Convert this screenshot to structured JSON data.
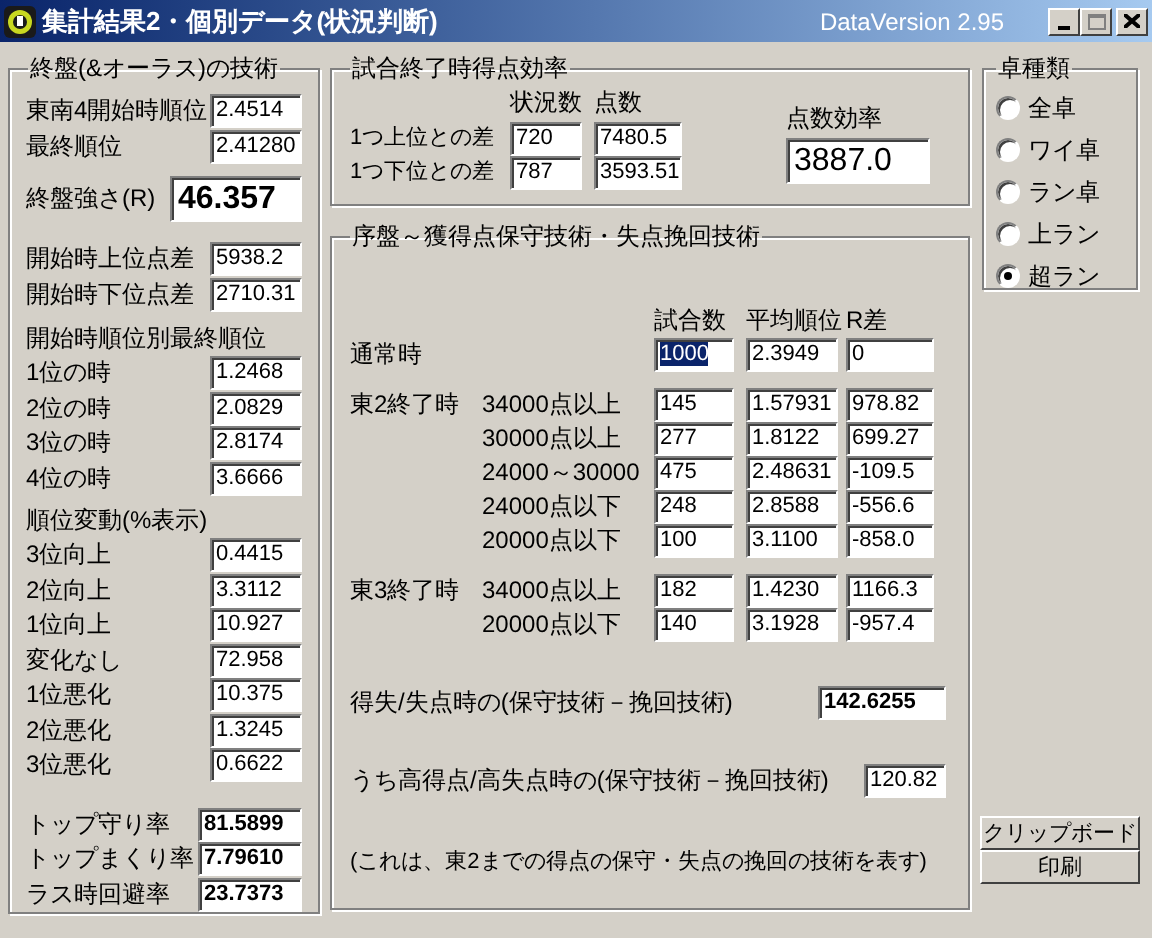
{
  "window": {
    "title": "集計結果2・個別データ(状況判断)",
    "version": "DataVersion 2.95"
  },
  "endgame": {
    "title": "終盤(&オーラス)の技術",
    "sections": [
      {
        "rows": [
          {
            "kind": "normal",
            "label": "東南4開始時順位",
            "value": "2.4514"
          },
          {
            "kind": "normal",
            "label": "最終順位",
            "value": "2.41280"
          },
          {
            "kind": "large",
            "label": "終盤強さ(R)",
            "value": "46.357"
          }
        ]
      },
      {
        "rows": [
          {
            "kind": "normal",
            "label": "開始時上位点差",
            "value": "5938.2"
          },
          {
            "kind": "normal",
            "label": "開始時下位点差",
            "value": "2710.31"
          }
        ]
      },
      {
        "heading": "開始時順位別最終順位",
        "rows": [
          {
            "kind": "normal",
            "label": "1位の時",
            "value": "1.2468"
          },
          {
            "kind": "normal",
            "label": "2位の時",
            "value": "2.0829"
          },
          {
            "kind": "normal",
            "label": "3位の時",
            "value": "2.8174"
          },
          {
            "kind": "normal",
            "label": "4位の時",
            "value": "3.6666"
          }
        ]
      },
      {
        "heading": "順位変動(%表示)",
        "rows": [
          {
            "kind": "normal",
            "label": "3位向上",
            "value": "0.4415"
          },
          {
            "kind": "normal",
            "label": "2位向上",
            "value": "3.3112"
          },
          {
            "kind": "normal",
            "label": "1位向上",
            "value": "10.927"
          },
          {
            "kind": "normal",
            "label": "変化なし",
            "value": "72.958"
          },
          {
            "kind": "normal",
            "label": "1位悪化",
            "value": "10.375"
          },
          {
            "kind": "normal",
            "label": "2位悪化",
            "value": "1.3245"
          },
          {
            "kind": "normal",
            "label": "3位悪化",
            "value": "0.6622"
          }
        ]
      },
      {
        "rows": [
          {
            "kind": "bold",
            "label": "トップ守り率",
            "value": "81.5899"
          },
          {
            "kind": "bold",
            "label": "トップまくり率",
            "value": "7.79610"
          },
          {
            "kind": "bold",
            "label": "ラス時回避率",
            "value": "23.7373"
          }
        ]
      }
    ]
  },
  "final_efficiency": {
    "title": "試合終了時得点効率",
    "columns": [
      "状況数",
      "点数"
    ],
    "rows": [
      {
        "label": "1つ上位との差",
        "count": "720",
        "points": "7480.5"
      },
      {
        "label": "1つ下位との差",
        "count": "787",
        "points": "3593.51"
      }
    ],
    "efficiency": {
      "label": "点数効率",
      "value": "3887.0"
    }
  },
  "technique": {
    "title": "序盤～獲得点保守技術・失点挽回技術",
    "columns": [
      "試合数",
      "平均順位",
      "R差"
    ],
    "groups": [
      {
        "label": "通常時",
        "rows": [
          {
            "cells": [
              {
                "text": "1000",
                "selected": true
              },
              {
                "text": "2.3949",
                "selected": false
              },
              {
                "text": "0",
                "selected": false
              }
            ]
          }
        ]
      },
      {
        "label": "東2終了時",
        "rows": [
          {
            "label": "34000点以上",
            "cells": [
              {
                "text": "145",
                "selected": false
              },
              {
                "text": "1.57931",
                "selected": false
              },
              {
                "text": "978.82",
                "selected": false
              }
            ]
          },
          {
            "label": "30000点以上",
            "cells": [
              {
                "text": "277",
                "selected": false
              },
              {
                "text": "1.8122",
                "selected": false
              },
              {
                "text": "699.27",
                "selected": false
              }
            ]
          },
          {
            "label": "24000～30000",
            "cells": [
              {
                "text": "475",
                "selected": false
              },
              {
                "text": "2.48631",
                "selected": false
              },
              {
                "text": "-109.5",
                "selected": false
              }
            ]
          },
          {
            "label": "24000点以下",
            "cells": [
              {
                "text": "248",
                "selected": false
              },
              {
                "text": "2.8588",
                "selected": false
              },
              {
                "text": "-556.6",
                "selected": false
              }
            ]
          },
          {
            "label": "20000点以下",
            "cells": [
              {
                "text": "100",
                "selected": false
              },
              {
                "text": "3.1100",
                "selected": false
              },
              {
                "text": "-858.0",
                "selected": false
              }
            ]
          }
        ]
      },
      {
        "label": "東3終了時",
        "rows": [
          {
            "label": "34000点以上",
            "cells": [
              {
                "text": "182",
                "selected": false
              },
              {
                "text": "1.4230",
                "selected": false
              },
              {
                "text": "1166.3",
                "selected": false
              }
            ]
          },
          {
            "label": "20000点以下",
            "cells": [
              {
                "text": "140",
                "selected": false
              },
              {
                "text": "3.1928",
                "selected": false
              },
              {
                "text": "-957.4",
                "selected": false
              }
            ]
          }
        ]
      }
    ],
    "totals": [
      {
        "kind": "bold",
        "label": "得失/失点時の(保守技術－挽回技術)",
        "value": "142.6255"
      },
      {
        "kind": "normal",
        "label": "うち高得点/高失点時の(保守技術－挽回技術)",
        "value": "120.82"
      }
    ],
    "note": "(これは、東2までの得点の保守・失点の挽回の技術を表す)"
  },
  "table_type": {
    "title": "卓種類",
    "options": [
      {
        "label": "全卓",
        "selected": false
      },
      {
        "label": "ワイ卓",
        "selected": false
      },
      {
        "label": "ラン卓",
        "selected": false
      },
      {
        "label": "上ラン",
        "selected": false
      },
      {
        "label": "超ラン",
        "selected": true
      }
    ]
  },
  "buttons": [
    "クリップボード",
    "印刷"
  ]
}
